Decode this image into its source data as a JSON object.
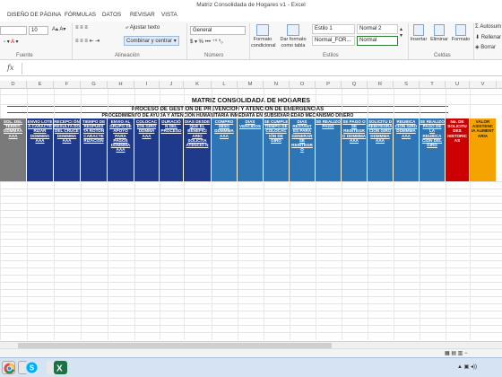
{
  "window": {
    "title": "Matriz Consolidada de Hogares v1 - Excel"
  },
  "menu": [
    "DISEÑO DE PÁGINA",
    "FÓRMULAS",
    "DATOS",
    "REVISAR",
    "VISTA"
  ],
  "ribbon": {
    "font_size": "10",
    "wrap_text": "Ajustar texto",
    "merge_center": "Combinar y centrar",
    "number_format": "General",
    "cond_format": "Formato condicional",
    "format_table": "Dar formato como tabla",
    "style1": "Estilo 1",
    "style2": "Normal 2",
    "style3": "Normal_FOR...",
    "style4": "Normal",
    "insert": "Insertar",
    "delete": "Eliminar",
    "format": "Formato",
    "autosum": "Autosum",
    "fill": "Rellenar",
    "clear": "Borrar",
    "group_font": "Fuente",
    "group_align": "Alineación",
    "group_number": "Número",
    "group_styles": "Estilos",
    "group_cells": "Celdas"
  },
  "formula_bar": {
    "fx": "fx",
    "value": ""
  },
  "columns": [
    "D",
    "E",
    "F",
    "G",
    "H",
    "I",
    "J",
    "K",
    "L",
    "M",
    "N",
    "O",
    "P",
    "Q",
    "R",
    "S",
    "T",
    "U",
    "V"
  ],
  "sheet": {
    "title": "MATRIZ CONSOLIDADA DE HOGARES",
    "subtitle1": "PROCESO DE GESTION DE PREVENCION Y ATENCION DE EMERGENCIAS",
    "subtitle2": "PROCEDIMIENTO DE AYUDA Y ATENCIÓN HUMANITARIA INMEDIATA EN SUBSIDIARIEDAD MECANISMO DINERO"
  },
  "headers": [
    "SOL. DEL TERRIT. DDMMAA AAA",
    "ENVIO LOTE A CARACTE RIZAR DDMMMA AAA",
    "RECEPCI ÓN RESULTA DO DEL CRUCE DDMMMA AAA",
    "TIEMPO DE RESPUES TA ROTON CARACTE RIZACION",
    "ENVIO AL GRUPO DE APOYO PARA PAGOS DDMMMA AAA",
    "COLOCAC IÓN GIRO DDMMA AAA",
    "DURACIÓ N DEL PROCESO",
    "DIAS DESDE QUE EL BENEFICI ARIO SOLICITA ATENCIÓ N",
    "COMPRO MISO DDMMMA AAA",
    "DIAS VENCIDOS",
    "SE CUMPLE TIEMPO DE COLOCAC IÓN DE GIRO",
    "DIAS RESTANT ES PARA GENERAR SE REINTEGR O",
    "SE REALIZO PAGO",
    "SE PAGO O SE REINTEGR O DDMMMA AAA",
    "SOLICITU D REINTEGRA CIÓN GIRO DDMMMA AAA",
    "REUBICA CIÓN GIRO DDMMMA AAA",
    "SE REALIZO PAGO DE LA REUBICA CIÓN DEL GIRO",
    "No. DE SOLICITU DES HISTORIC AS",
    "VALOR ASISTENC IA AUMENT ARIA"
  ]
}
